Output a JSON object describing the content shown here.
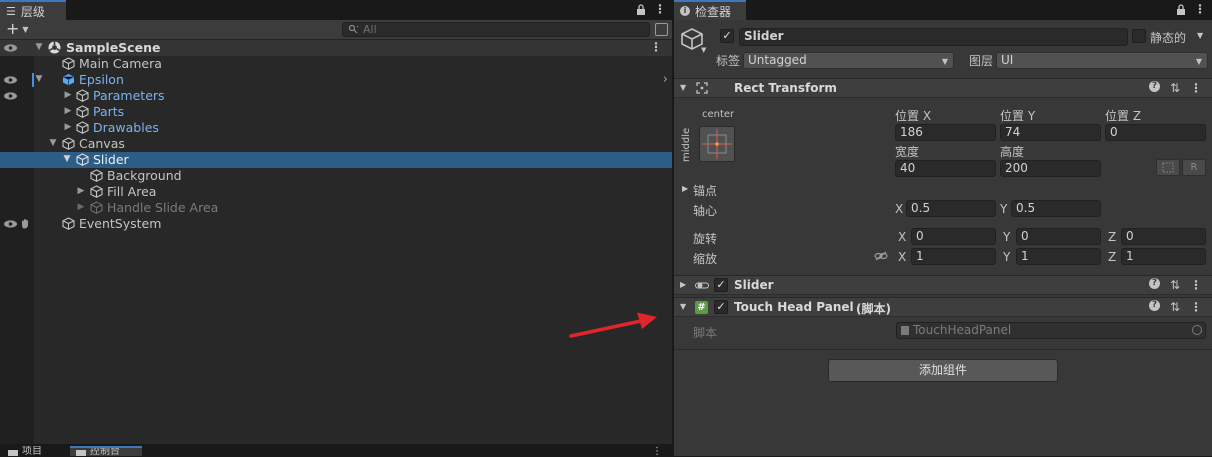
{
  "hierarchy": {
    "tab_label": "层级",
    "search_placeholder": "All",
    "scene_name": "SampleScene",
    "items": [
      {
        "label": "Main Camera"
      },
      {
        "label": "Epsilon"
      },
      {
        "label": "Parameters"
      },
      {
        "label": "Parts"
      },
      {
        "label": "Drawables"
      },
      {
        "label": "Canvas"
      },
      {
        "label": "Slider"
      },
      {
        "label": "Background"
      },
      {
        "label": "Fill Area"
      },
      {
        "label": "Handle Slide Area"
      },
      {
        "label": "EventSystem"
      }
    ]
  },
  "bottom_tabs": {
    "project": "项目",
    "console": "控制台"
  },
  "inspector": {
    "tab_label": "检查器",
    "object_name": "Slider",
    "static_label": "静态的",
    "tag_label": "标签",
    "tag_value": "Untagged",
    "layer_label": "图层",
    "layer_value": "UI",
    "rect_transform": {
      "title": "Rect Transform",
      "anchor_h": "center",
      "anchor_v": "middle",
      "pos_x_label": "位置 X",
      "pos_y_label": "位置 Y",
      "pos_z_label": "位置 Z",
      "pos_x": "186",
      "pos_y": "74",
      "pos_z": "0",
      "width_label": "宽度",
      "height_label": "高度",
      "width": "40",
      "height": "200",
      "r_button": "R",
      "anchors_label": "锚点",
      "pivot_label": "轴心",
      "pivot_x_label": "X",
      "pivot_x": "0.5",
      "pivot_y_label": "Y",
      "pivot_y": "0.5",
      "rotation_label": "旋转",
      "rot_x": "0",
      "rot_y": "0",
      "rot_z": "0",
      "scale_label": "缩放",
      "scale_x": "1",
      "scale_y": "1",
      "scale_z": "1",
      "axis_x": "X",
      "axis_y": "Y",
      "axis_z": "Z"
    },
    "slider_component": {
      "title": "Slider"
    },
    "touch_head_panel": {
      "title": "Touch Head Panel",
      "suffix": "(脚本)",
      "script_label": "脚本",
      "script_value": "TouchHeadPanel"
    },
    "add_component": "添加组件"
  },
  "colors": {
    "selection": "#2c5d87",
    "prefab_blue": "#7bb2f2",
    "annotation_arrow": "#e0262b",
    "tab_accent": "#3a79bb"
  }
}
